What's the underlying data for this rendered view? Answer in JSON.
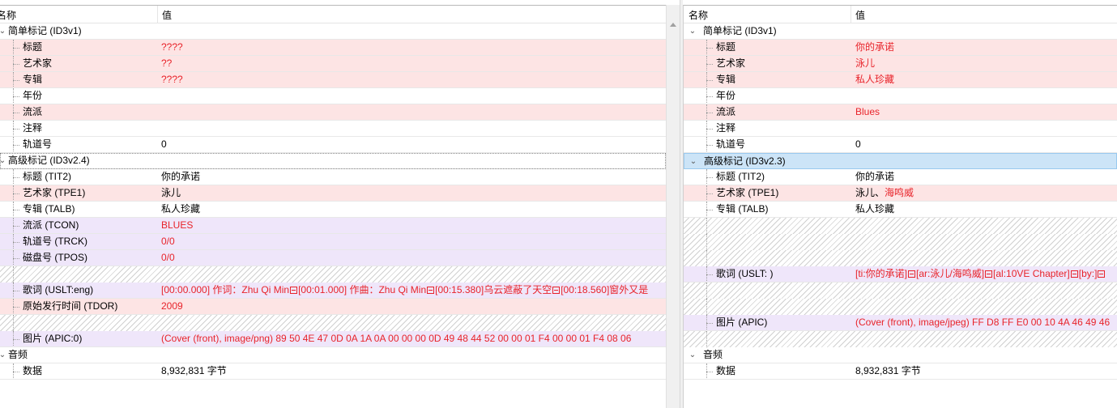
{
  "header": {
    "name": "名称",
    "value": "值"
  },
  "left": {
    "groups": [
      {
        "label": "简单标记 (ID3v1)",
        "rows": [
          {
            "label": "标题",
            "value": "????",
            "style": "pink",
            "red": true
          },
          {
            "label": "艺术家",
            "value": "??",
            "style": "pink",
            "red": true
          },
          {
            "label": "专辑",
            "value": "????",
            "style": "pink",
            "red": true
          },
          {
            "label": "年份",
            "value": "",
            "style": "",
            "red": false
          },
          {
            "label": "流派",
            "value": "",
            "style": "pink",
            "red": false
          },
          {
            "label": "注释",
            "value": "",
            "style": "",
            "red": false
          },
          {
            "label": "轨道号",
            "value": "0",
            "style": "",
            "red": false
          }
        ]
      },
      {
        "label": "高级标记 (ID3v2.4)",
        "rows": [
          {
            "label": "标题 (TIT2)",
            "value": "你的承诺",
            "style": "",
            "red": false
          },
          {
            "label": "艺术家 (TPE1)",
            "value": "泳儿",
            "style": "pink",
            "red": false
          },
          {
            "label": "专辑 (TALB)",
            "value": "私人珍藏",
            "style": "",
            "red": false
          },
          {
            "label": "流派 (TCON)",
            "value": "BLUES",
            "style": "lav",
            "red": true
          },
          {
            "label": "轨道号 (TRCK)",
            "value": "0/0",
            "style": "lav",
            "red": true
          },
          {
            "label": "磁盘号 (TPOS)",
            "value": "0/0",
            "style": "lav",
            "red": true
          },
          {
            "label": "",
            "value": "",
            "style": "hatch",
            "red": false
          },
          {
            "label": "歌词 (USLT:eng)",
            "value": "[00:00.000] 作词：Zhu Qi Min◙[00:01.000] 作曲：Zhu Qi Min◙[00:15.380]乌云遮蔽了天空◙[00:18.560]窗外又是",
            "style": "lav",
            "red": true
          },
          {
            "label": "原始发行时间 (TDOR)",
            "value": "2009",
            "style": "pink",
            "red": true
          },
          {
            "label": "",
            "value": "",
            "style": "hatch",
            "red": false
          },
          {
            "label": "图片 (APIC:0)",
            "value": "(Cover (front), image/png) 89 50 4E 47 0D 0A 1A 0A 00 00 00 0D 49 48 44 52 00 00 01 F4 00 00 01 F4 08 06",
            "style": "lav",
            "red": true
          }
        ]
      },
      {
        "label": "音频",
        "rows": [
          {
            "label": "数据",
            "value": "8,932,831 字节",
            "style": "",
            "red": false
          }
        ]
      }
    ]
  },
  "right": {
    "groups": [
      {
        "label": "简单标记 (ID3v1)",
        "rows": [
          {
            "label": "标题",
            "value": "你的承诺",
            "style": "pink",
            "red": true
          },
          {
            "label": "艺术家",
            "value": "泳儿",
            "style": "pink",
            "red": true
          },
          {
            "label": "专辑",
            "value": "私人珍藏",
            "style": "pink",
            "red": true
          },
          {
            "label": "年份",
            "value": "",
            "style": "",
            "red": false
          },
          {
            "label": "流派",
            "value": "Blues",
            "style": "pink",
            "red": true
          },
          {
            "label": "注释",
            "value": "",
            "style": "",
            "red": false
          },
          {
            "label": "轨道号",
            "value": "0",
            "style": "",
            "red": false
          }
        ]
      },
      {
        "label": "高级标记 (ID3v2.3)",
        "selected": true,
        "rows": [
          {
            "label": "标题 (TIT2)",
            "value": "你的承诺",
            "style": "",
            "red": false
          },
          {
            "label": "艺术家 (TPE1)",
            "value": "泳儿、海鸣威",
            "style": "pink",
            "red": false,
            "value_suffix": "海鸣威"
          },
          {
            "label": "专辑 (TALB)",
            "value": "私人珍藏",
            "style": "",
            "red": false
          },
          {
            "label": "",
            "value": "",
            "style": "hatch",
            "red": false
          },
          {
            "label": "",
            "value": "",
            "style": "hatch",
            "red": false
          },
          {
            "label": "",
            "value": "",
            "style": "hatch",
            "red": false
          },
          {
            "label": "歌词 (USLT:   )",
            "value": "[ti:你的承诺]◙[ar:泳儿/海鸣威]◙[al:10VE Chapter]◙[by:]◙",
            "style": "lav",
            "red": true
          },
          {
            "label": "",
            "value": "",
            "style": "hatch",
            "red": false
          },
          {
            "label": "",
            "value": "",
            "style": "hatch",
            "red": false
          },
          {
            "label": "图片 (APIC)",
            "value": "(Cover (front), image/jpeg) FF D8 FF E0 00 10 4A 46 49 46",
            "style": "lav",
            "red": true
          },
          {
            "label": "",
            "value": "",
            "style": "hatch",
            "red": false
          }
        ]
      },
      {
        "label": "音频",
        "rows": [
          {
            "label": "数据",
            "value": "8,932,831 字节",
            "style": "",
            "red": false
          }
        ]
      }
    ]
  }
}
